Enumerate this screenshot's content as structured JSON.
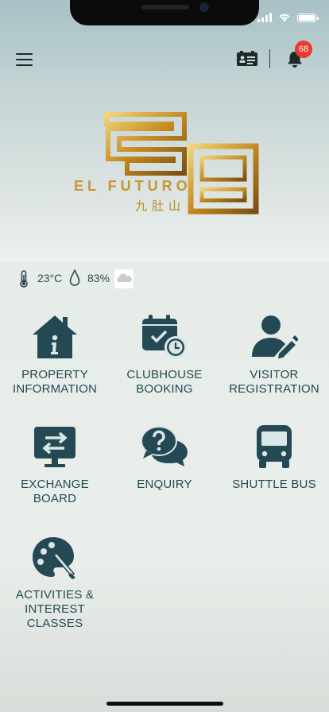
{
  "header": {
    "badge_count": "68"
  },
  "logo": {
    "name": "EL FUTURO",
    "name_cn": "九肚山"
  },
  "weather": {
    "temperature": "23°C",
    "humidity": "83%"
  },
  "tiles": [
    {
      "label": "PROPERTY\nINFORMATION"
    },
    {
      "label": "CLUBHOUSE\nBOOKING"
    },
    {
      "label": "VISITOR\nREGISTRATION"
    },
    {
      "label": "EXCHANGE\nBOARD"
    },
    {
      "label": "ENQUIRY"
    },
    {
      "label": "SHUTTLE BUS"
    },
    {
      "label": "ACTIVITIES &\nINTEREST\nCLASSES"
    }
  ],
  "colors": {
    "icon": "#244955",
    "badge": "#e63b2e",
    "gold": "#c8962e"
  }
}
